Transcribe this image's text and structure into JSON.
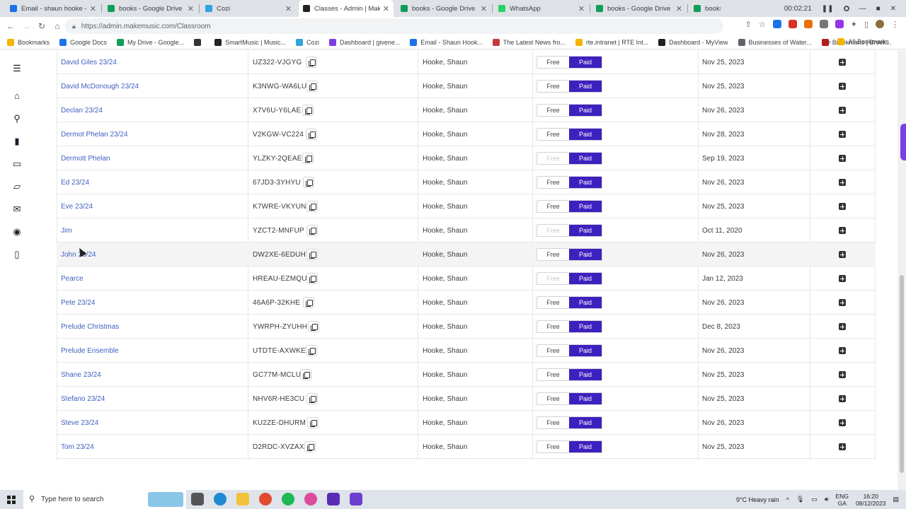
{
  "browser": {
    "tabs": [
      {
        "title": "Email - shaun hooke - Ou",
        "color": "#1a73e8"
      },
      {
        "title": "books - Google Drive",
        "color": "#0f9d58"
      },
      {
        "title": "Cozi",
        "color": "#2fa3dc"
      },
      {
        "title": "Classes - Admin | MakeM",
        "color": "#222"
      },
      {
        "title": "books - Google Drive",
        "color": "#0f9d58"
      },
      {
        "title": "WhatsApp",
        "color": "#25d366"
      },
      {
        "title": "books - Google Drive",
        "color": "#0f9d58"
      },
      {
        "title": "books",
        "color": "#0f9d58"
      }
    ],
    "recording_time": "00:02:21",
    "url": "https://admin.makemusic.com/Classroom",
    "bookmarks": [
      "Bookmarks",
      "Google Docs",
      "My Drive - Google...",
      "",
      "SmartMusic | Music...",
      "Cozi",
      "Dashboard | givene...",
      "Email - Shaun Hook...",
      "The Latest News fro...",
      "rte.intranet | RTE Int...",
      "Dashboard - MyView",
      "Businesses of Water...",
      "Broekmans | Broek..."
    ],
    "all_bookmarks": "All Bookmarks"
  },
  "table": {
    "free_label": "Free",
    "paid_label": "Paid",
    "rows": [
      {
        "name": "David Giles 23/24",
        "code": "UZ322-VJGYG",
        "teacher": "Hooke, Shaun",
        "free_dim": false,
        "date": "Nov 25, 2023"
      },
      {
        "name": "David McDonough 23/24",
        "code": "K3NWG-WA6LU",
        "teacher": "Hooke, Shaun",
        "free_dim": false,
        "date": "Nov 25, 2023"
      },
      {
        "name": "Declan 23/24",
        "code": "X7V6U-Y6LAE",
        "teacher": "Hooke, Shaun",
        "free_dim": false,
        "date": "Nov 26, 2023"
      },
      {
        "name": "Dermot Phelan 23/24",
        "code": "V2KGW-VC224",
        "teacher": "Hooke, Shaun",
        "free_dim": false,
        "date": "Nov 28, 2023"
      },
      {
        "name": "Dermott Phelan",
        "code": "YLZKY-2QEAE",
        "teacher": "Hooke, Shaun",
        "free_dim": true,
        "date": "Sep 19, 2023"
      },
      {
        "name": "Ed 23/24",
        "code": "67JD3-3YHYU",
        "teacher": "Hooke, Shaun",
        "free_dim": false,
        "date": "Nov 26, 2023"
      },
      {
        "name": "Eve 23/24",
        "code": "K7WRE-VKYUN",
        "teacher": "Hooke, Shaun",
        "free_dim": false,
        "date": "Nov 25, 2023"
      },
      {
        "name": "Jim",
        "code": "YZCT2-MNFUP",
        "teacher": "Hooke, Shaun",
        "free_dim": true,
        "date": "Oct 11, 2020"
      },
      {
        "name": "John 23/24",
        "code": "DW2XE-6EDUH",
        "teacher": "Hooke, Shaun",
        "free_dim": false,
        "date": "Nov 26, 2023"
      },
      {
        "name": "Pearce",
        "code": "HREAU-EZMQU",
        "teacher": "Hooke, Shaun",
        "free_dim": true,
        "date": "Jan 12, 2023"
      },
      {
        "name": "Pete 23/24",
        "code": "46A6P-32KHE",
        "teacher": "Hooke, Shaun",
        "free_dim": false,
        "date": "Nov 26, 2023"
      },
      {
        "name": "Prelude Christmas",
        "code": "YWRPH-ZYUHH",
        "teacher": "Hooke, Shaun",
        "free_dim": false,
        "date": "Dec 8, 2023"
      },
      {
        "name": "Prelude Ensemble",
        "code": "UTDTE-AXWKE",
        "teacher": "Hooke, Shaun",
        "free_dim": false,
        "date": "Nov 26, 2023"
      },
      {
        "name": "Shane 23/24",
        "code": "GC77M-MCLU7",
        "teacher": "Hooke, Shaun",
        "free_dim": false,
        "date": "Nov 25, 2023"
      },
      {
        "name": "Stefano 23/24",
        "code": "NHV6R-HE3CU",
        "teacher": "Hooke, Shaun",
        "free_dim": false,
        "date": "Nov 25, 2023"
      },
      {
        "name": "Steve 23/24",
        "code": "KU2ZE-DHURM",
        "teacher": "Hooke, Shaun",
        "free_dim": false,
        "date": "Nov 26, 2023"
      },
      {
        "name": "Tom 23/24",
        "code": "D2RDC-XVZAX",
        "teacher": "Hooke, Shaun",
        "free_dim": false,
        "date": "Nov 25, 2023"
      }
    ]
  },
  "taskbar": {
    "search_placeholder": "Type here to search",
    "weather": "9°C  Heavy rain",
    "lang_top": "ENG",
    "lang_bottom": "GA",
    "time": "16:20",
    "date": "08/12/2023"
  }
}
